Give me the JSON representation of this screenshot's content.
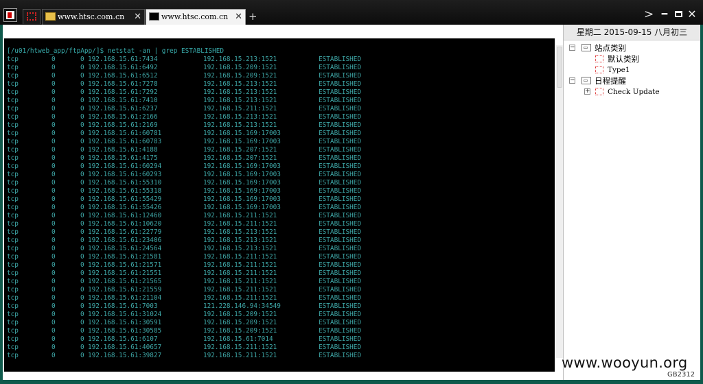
{
  "tabs": [
    {
      "label": "www.htsc.com.cn",
      "close": "✕",
      "icon": "folder-icon",
      "active": false
    },
    {
      "label": "www.htsc.com.cn",
      "close": "✕",
      "icon": "terminal-icon",
      "active": true
    }
  ],
  "new_tab": "+",
  "terminal": {
    "prompt": "[/u01/htweb_app/ftpApp/]$ netstat -an | grep ESTABLISHED",
    "text_color": "#3ea6a6",
    "rows": [
      [
        "tcp",
        "0",
        "0",
        "192.168.15.61:7434",
        "192.168.15.213:1521",
        "ESTABLISHED"
      ],
      [
        "tcp",
        "0",
        "0",
        "192.168.15.61:6492",
        "192.168.15.209:1521",
        "ESTABLISHED"
      ],
      [
        "tcp",
        "0",
        "0",
        "192.168.15.61:6512",
        "192.168.15.209:1521",
        "ESTABLISHED"
      ],
      [
        "tcp",
        "0",
        "0",
        "192.168.15.61:7278",
        "192.168.15.213:1521",
        "ESTABLISHED"
      ],
      [
        "tcp",
        "0",
        "0",
        "192.168.15.61:7292",
        "192.168.15.213:1521",
        "ESTABLISHED"
      ],
      [
        "tcp",
        "0",
        "0",
        "192.168.15.61:7410",
        "192.168.15.213:1521",
        "ESTABLISHED"
      ],
      [
        "tcp",
        "0",
        "0",
        "192.168.15.61:6237",
        "192.168.15.211:1521",
        "ESTABLISHED"
      ],
      [
        "tcp",
        "0",
        "0",
        "192.168.15.61:2166",
        "192.168.15.213:1521",
        "ESTABLISHED"
      ],
      [
        "tcp",
        "0",
        "0",
        "192.168.15.61:2169",
        "192.168.15.213:1521",
        "ESTABLISHED"
      ],
      [
        "tcp",
        "0",
        "0",
        "192.168.15.61:60781",
        "192.168.15.169:17003",
        "ESTABLISHED"
      ],
      [
        "tcp",
        "0",
        "0",
        "192.168.15.61:60783",
        "192.168.15.169:17003",
        "ESTABLISHED"
      ],
      [
        "tcp",
        "0",
        "0",
        "192.168.15.61:4188",
        "192.168.15.207:1521",
        "ESTABLISHED"
      ],
      [
        "tcp",
        "0",
        "0",
        "192.168.15.61:4175",
        "192.168.15.207:1521",
        "ESTABLISHED"
      ],
      [
        "tcp",
        "0",
        "0",
        "192.168.15.61:60294",
        "192.168.15.169:17003",
        "ESTABLISHED"
      ],
      [
        "tcp",
        "0",
        "0",
        "192.168.15.61:60293",
        "192.168.15.169:17003",
        "ESTABLISHED"
      ],
      [
        "tcp",
        "0",
        "0",
        "192.168.15.61:55310",
        "192.168.15.169:17003",
        "ESTABLISHED"
      ],
      [
        "tcp",
        "0",
        "0",
        "192.168.15.61:55318",
        "192.168.15.169:17003",
        "ESTABLISHED"
      ],
      [
        "tcp",
        "0",
        "0",
        "192.168.15.61:55429",
        "192.168.15.169:17003",
        "ESTABLISHED"
      ],
      [
        "tcp",
        "0",
        "0",
        "192.168.15.61:55426",
        "192.168.15.169:17003",
        "ESTABLISHED"
      ],
      [
        "tcp",
        "0",
        "0",
        "192.168.15.61:12460",
        "192.168.15.211:1521",
        "ESTABLISHED"
      ],
      [
        "tcp",
        "0",
        "0",
        "192.168.15.61:10620",
        "192.168.15.211:1521",
        "ESTABLISHED"
      ],
      [
        "tcp",
        "0",
        "0",
        "192.168.15.61:22779",
        "192.168.15.213:1521",
        "ESTABLISHED"
      ],
      [
        "tcp",
        "0",
        "0",
        "192.168.15.61:23406",
        "192.168.15.213:1521",
        "ESTABLISHED"
      ],
      [
        "tcp",
        "0",
        "0",
        "192.168.15.61:24564",
        "192.168.15.213:1521",
        "ESTABLISHED"
      ],
      [
        "tcp",
        "0",
        "0",
        "192.168.15.61:21581",
        "192.168.15.211:1521",
        "ESTABLISHED"
      ],
      [
        "tcp",
        "0",
        "0",
        "192.168.15.61:21571",
        "192.168.15.211:1521",
        "ESTABLISHED"
      ],
      [
        "tcp",
        "0",
        "0",
        "192.168.15.61:21551",
        "192.168.15.211:1521",
        "ESTABLISHED"
      ],
      [
        "tcp",
        "0",
        "0",
        "192.168.15.61:21565",
        "192.168.15.211:1521",
        "ESTABLISHED"
      ],
      [
        "tcp",
        "0",
        "0",
        "192.168.15.61:21559",
        "192.168.15.211:1521",
        "ESTABLISHED"
      ],
      [
        "tcp",
        "0",
        "0",
        "192.168.15.61:21104",
        "192.168.15.211:1521",
        "ESTABLISHED"
      ],
      [
        "tcp",
        "0",
        "0",
        "192.168.15.61:7003",
        "121.228.146.94:34549",
        "ESTABLISHED"
      ],
      [
        "tcp",
        "0",
        "0",
        "192.168.15.61:31024",
        "192.168.15.209:1521",
        "ESTABLISHED"
      ],
      [
        "tcp",
        "0",
        "0",
        "192.168.15.61:30591",
        "192.168.15.209:1521",
        "ESTABLISHED"
      ],
      [
        "tcp",
        "0",
        "0",
        "192.168.15.61:30585",
        "192.168.15.209:1521",
        "ESTABLISHED"
      ],
      [
        "tcp",
        "0",
        "0",
        "192.168.15.61:6107",
        "192.168.15.61:7014",
        "ESTABLISHED"
      ],
      [
        "tcp",
        "0",
        "0",
        "192.168.15.61:40657",
        "192.168.15.211:1521",
        "ESTABLISHED"
      ],
      [
        "tcp",
        "0",
        "0",
        "192.168.15.61:39827",
        "192.168.15.211:1521",
        "ESTABLISHED"
      ]
    ]
  },
  "side": {
    "date": "星期二 2015-09-15 八月初三",
    "tree": {
      "site_category": "站点类别",
      "default_category": "默认类别",
      "type1": "Type1",
      "schedule_reminder": "日程提醒",
      "check_update": "Check Update",
      "expanded_glyph": "−",
      "collapsed_glyph": "+"
    }
  },
  "watermark": "www.wooyun.org",
  "status_code": "GB2312"
}
